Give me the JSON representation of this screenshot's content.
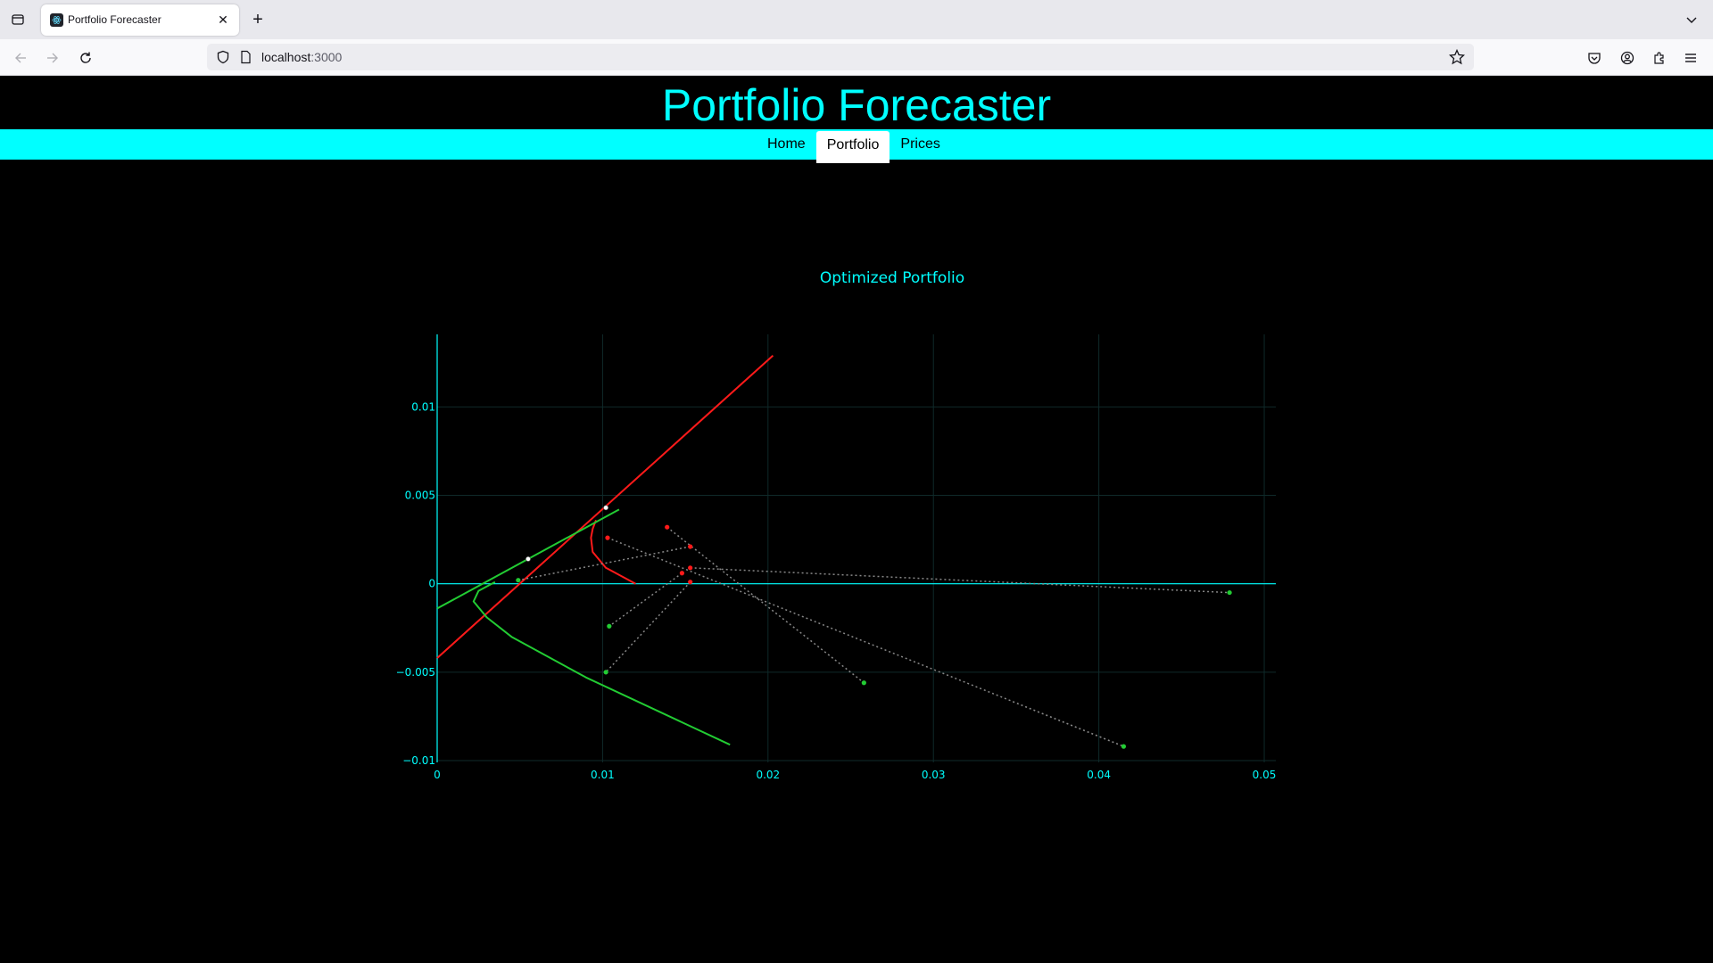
{
  "browser": {
    "tab_title": "Portfolio Forecaster",
    "url_host": "localhost",
    "url_port": ":3000"
  },
  "app": {
    "title": "Portfolio Forecaster",
    "menu": [
      {
        "label": "Home",
        "active": false
      },
      {
        "label": "Portfolio",
        "active": true
      },
      {
        "label": "Prices",
        "active": false
      }
    ],
    "accent_color": "#00ffff"
  },
  "chart_data": {
    "type": "scatter",
    "title": "Optimized Portfolio",
    "xlabel": "",
    "ylabel": "",
    "xlim": [
      0,
      0.0507
    ],
    "ylim": [
      -0.0101,
      0.0141
    ],
    "x_ticks": [
      0,
      0.01,
      0.02,
      0.03,
      0.04,
      0.05
    ],
    "x_tick_labels": [
      "0",
      "0.01",
      "0.02",
      "0.03",
      "0.04",
      "0.05"
    ],
    "y_ticks": [
      -0.01,
      -0.005,
      0,
      0.005,
      0.01
    ],
    "y_tick_labels": [
      "−0.01",
      "−0.005",
      "0",
      "0.005",
      "0.01"
    ],
    "grid": true,
    "colors": {
      "axis": "#00ffff",
      "red": "#ff1a1a",
      "green": "#22cc33",
      "connector": "#888888",
      "highlight": "#ffffff"
    },
    "series": [
      {
        "color": "red",
        "style": "line",
        "x": [
          0,
          0.0203
        ],
        "y": [
          -0.0042,
          0.0129
        ]
      },
      {
        "color": "red",
        "style": "curve",
        "x": [
          0.012,
          0.0102,
          0.0094,
          0.0093,
          0.0094,
          0.0096
        ],
        "y": [
          0,
          0.0009,
          0.0018,
          0.0026,
          0.0031,
          0.0036
        ]
      },
      {
        "color": "green",
        "style": "line",
        "x": [
          0,
          0.011
        ],
        "y": [
          -0.0014,
          0.0042
        ]
      },
      {
        "color": "green",
        "style": "curve",
        "x": [
          0.0177,
          0.009,
          0.0045,
          0.003,
          0.0022,
          0.0025,
          0.0035
        ],
        "y": [
          -0.0091,
          -0.0053,
          -0.003,
          -0.0019,
          -0.001,
          -0.0004,
          0.0001
        ]
      },
      {
        "color": "connector",
        "style": "dotted",
        "x": [
          0.0139,
          0.0258
        ],
        "y": [
          0.0032,
          -0.0056
        ]
      },
      {
        "color": "connector",
        "style": "dotted",
        "x": [
          0.0103,
          0.0415
        ],
        "y": [
          0.0026,
          -0.0092
        ]
      },
      {
        "color": "connector",
        "style": "dotted",
        "x": [
          0.0153,
          0.0479
        ],
        "y": [
          0.0009,
          -0.0005
        ]
      },
      {
        "color": "connector",
        "style": "dotted",
        "x": [
          0.0153,
          0.0049
        ],
        "y": [
          0.0021,
          0.0002
        ]
      },
      {
        "color": "connector",
        "style": "dotted",
        "x": [
          0.0148,
          0.0104
        ],
        "y": [
          0.0006,
          -0.0024
        ]
      },
      {
        "color": "connector",
        "style": "dotted",
        "x": [
          0.0153,
          0.0102
        ],
        "y": [
          0.0001,
          -0.005
        ]
      }
    ],
    "points": [
      {
        "color": "red",
        "x": 0.0139,
        "y": 0.0032
      },
      {
        "color": "red",
        "x": 0.0103,
        "y": 0.0026
      },
      {
        "color": "red",
        "x": 0.0153,
        "y": 0.0021
      },
      {
        "color": "red",
        "x": 0.0153,
        "y": 0.0009
      },
      {
        "color": "red",
        "x": 0.0148,
        "y": 0.0006
      },
      {
        "color": "red",
        "x": 0.0153,
        "y": 0.0001
      },
      {
        "color": "green",
        "x": 0.0258,
        "y": -0.0056
      },
      {
        "color": "green",
        "x": 0.0415,
        "y": -0.0092
      },
      {
        "color": "green",
        "x": 0.0479,
        "y": -0.0005
      },
      {
        "color": "green",
        "x": 0.0049,
        "y": 0.0002
      },
      {
        "color": "green",
        "x": 0.0104,
        "y": -0.0024
      },
      {
        "color": "green",
        "x": 0.0102,
        "y": -0.005
      },
      {
        "color": "highlight",
        "x": 0.0102,
        "y": 0.0043
      },
      {
        "color": "highlight",
        "x": 0.0055,
        "y": 0.0014
      }
    ]
  }
}
